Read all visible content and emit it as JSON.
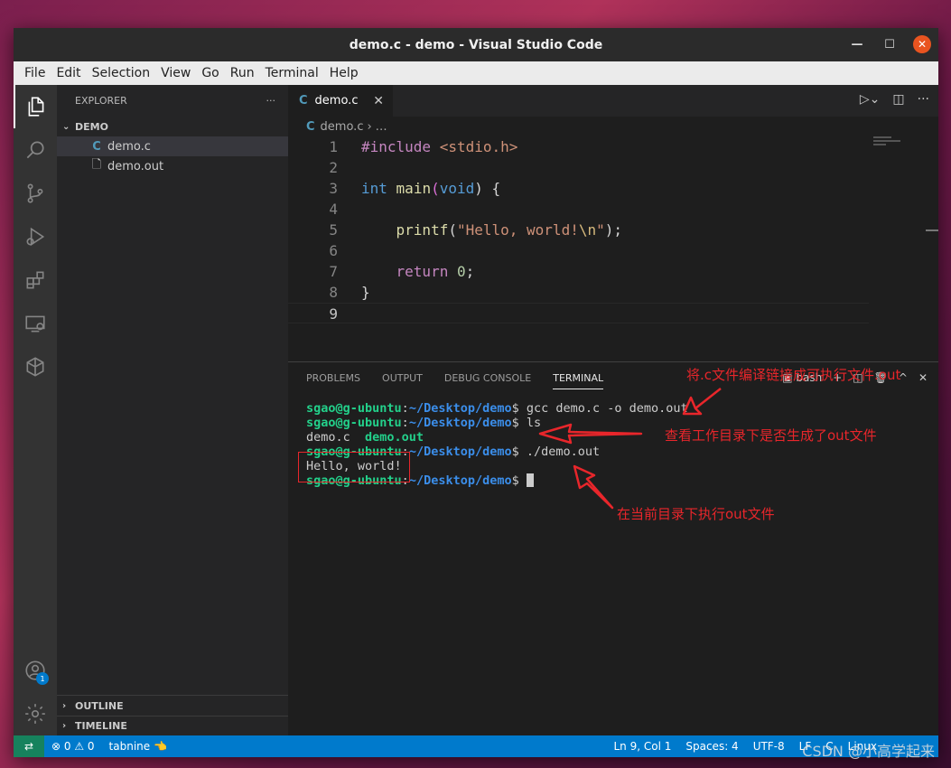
{
  "window": {
    "title": "demo.c - demo - Visual Studio Code"
  },
  "menu": [
    "File",
    "Edit",
    "Selection",
    "View",
    "Go",
    "Run",
    "Terminal",
    "Help"
  ],
  "explorer": {
    "header": "EXPLORER",
    "more": "···",
    "folder": "DEMO",
    "files": [
      {
        "name": "demo.c",
        "icon": "c-file-icon"
      },
      {
        "name": "demo.out",
        "icon": "file-icon"
      }
    ],
    "outline": "OUTLINE",
    "timeline": "TIMELINE"
  },
  "editor": {
    "tab_label": "demo.c",
    "breadcrumb_file": "demo.c",
    "breadcrumb_more": "…",
    "lines": [
      "1",
      "2",
      "3",
      "4",
      "5",
      "6",
      "7",
      "8",
      "9"
    ],
    "code": {
      "l1_pre": "#include",
      "l1_hdr": "<stdio.h>",
      "l3_type": "int",
      "l3_fn": "main",
      "l3_paren_open": "(",
      "l3_void": "void",
      "l3_rest": ") {",
      "l5_fn": "printf",
      "l5_open": "(",
      "l5_str1": "\"Hello, world!",
      "l5_esc": "\\n",
      "l5_str2": "\"",
      "l5_close": ");",
      "l7_kw": "return",
      "l7_num": "0",
      "l7_semi": ";",
      "l8": "}"
    }
  },
  "panel": {
    "tabs": [
      "PROBLEMS",
      "OUTPUT",
      "DEBUG CONSOLE",
      "TERMINAL"
    ],
    "active_tab": "TERMINAL",
    "shell": "bash",
    "terminal": {
      "user": "sgao@g-ubuntu",
      "sep": ":",
      "path": "~/Desktop/demo",
      "prompt": "$ ",
      "cmd1": "gcc demo.c -o demo.out",
      "cmd2": "ls",
      "ls_file1": "demo.c  ",
      "ls_file2": "demo.out",
      "cmd3": "./demo.out",
      "output": "Hello, world!"
    }
  },
  "statusbar": {
    "problems": "⊗ 0 ⚠ 0",
    "tabnine": "tabnine 👈",
    "position": "Ln 9, Col 1",
    "spaces": "Spaces: 4",
    "encoding": "UTF-8",
    "eol": "LF",
    "lang": "C",
    "os": "Linux"
  },
  "annotations": {
    "compile": "将.c文件编译链接成可执行文件.out",
    "list": "查看工作目录下是否生成了out文件",
    "run": "在当前目录下执行out文件"
  },
  "watermark": "CSDN @小高学起来"
}
